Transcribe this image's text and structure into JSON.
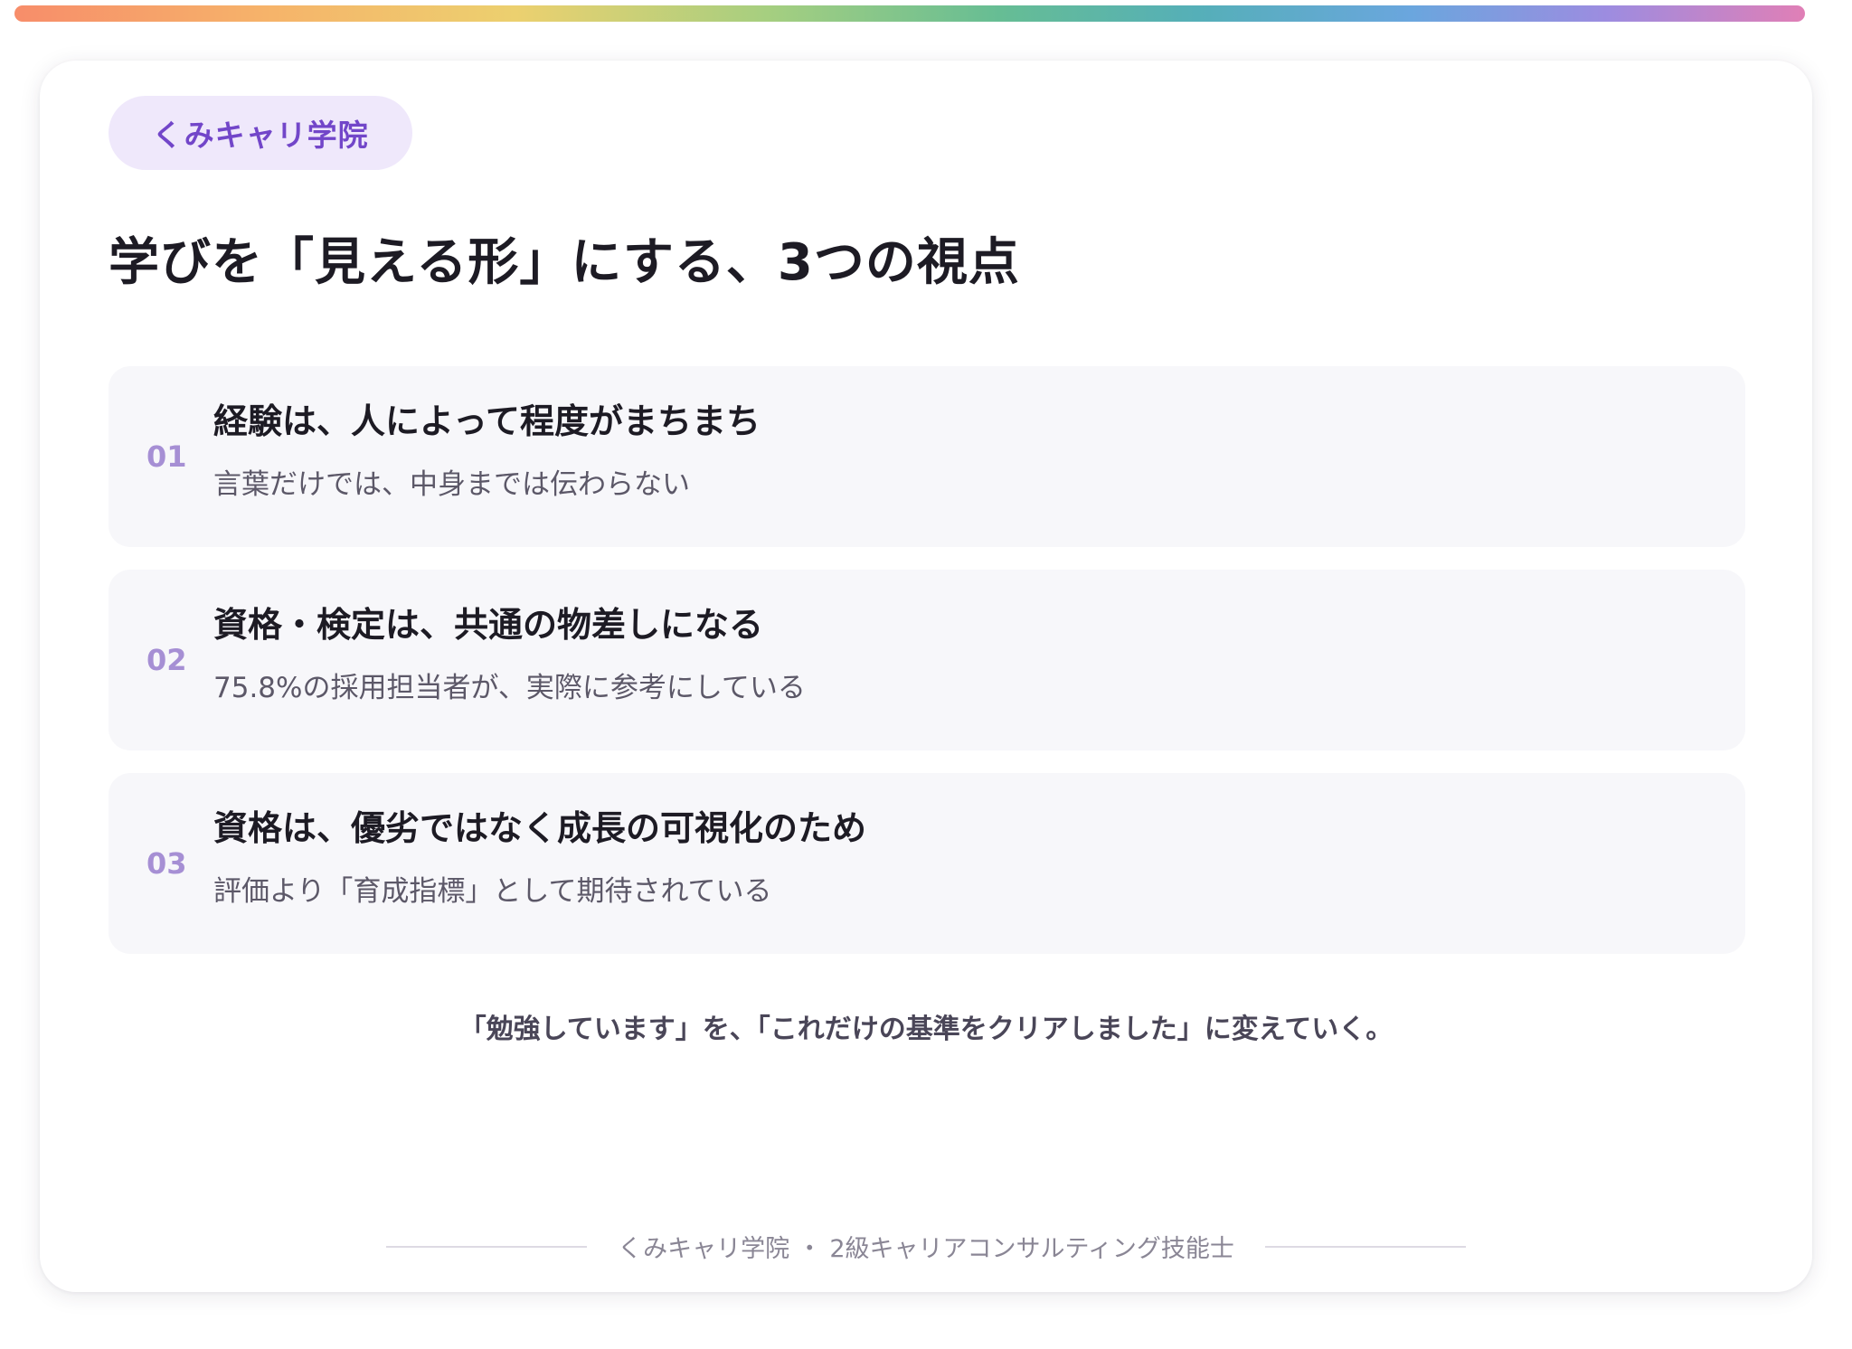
{
  "badge": "くみキャリ学院",
  "title": "学びを「見える形」にする、3つの視点",
  "items": [
    {
      "num": "01",
      "title": "経験は、人によって程度がまちまち",
      "desc": "言葉だけでは、中身までは伝わらない"
    },
    {
      "num": "02",
      "title": "資格・検定は、共通の物差しになる",
      "desc": "75.8%の採用担当者が、実際に参考にしている"
    },
    {
      "num": "03",
      "title": "資格は、優劣ではなく成長の可視化のため",
      "desc": "評価より「育成指標」として期待されている"
    }
  ],
  "tagline": "「勉強しています」を、「これだけの基準をクリアしました」に変えていく。",
  "footer": "くみキャリ学院 ・ 2級キャリアコンサルティング技能士",
  "colors": {
    "accent": "#7246c9",
    "badge_bg": "#efe8fb",
    "number": "#a68fd4",
    "item_bg": "#f7f7fa"
  }
}
